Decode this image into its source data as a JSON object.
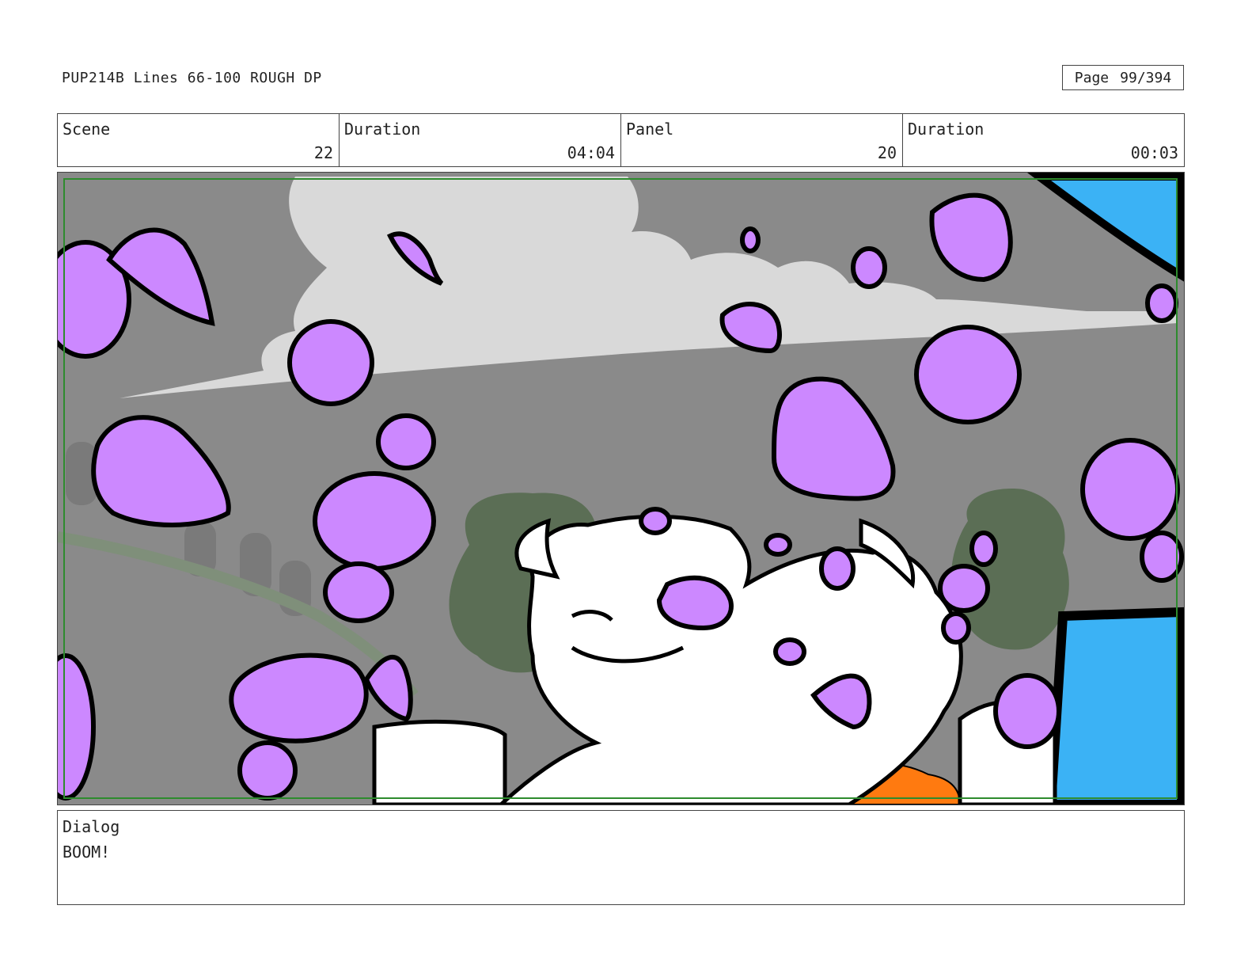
{
  "header": {
    "title": "PUP214B Lines 66-100 ROUGH DP",
    "page_label": "Page",
    "page_number": "99/394"
  },
  "info": {
    "scene_label": "Scene",
    "scene_value": "22",
    "scene_duration_label": "Duration",
    "scene_duration_value": "04:04",
    "panel_label": "Panel",
    "panel_value": "20",
    "panel_duration_label": "Duration",
    "panel_duration_value": "00:03"
  },
  "dialog": {
    "label": "Dialog",
    "text": "BOOM!"
  },
  "colors": {
    "sky": "#8a8a8a",
    "smoke": "#d9d9d9",
    "balloon": "#cc88ff",
    "outline": "#000000",
    "cyan": "#3bb2f5",
    "orange": "#ff7a10",
    "tree": "#5b6e55",
    "safe_frame": "#2e8b2e"
  }
}
